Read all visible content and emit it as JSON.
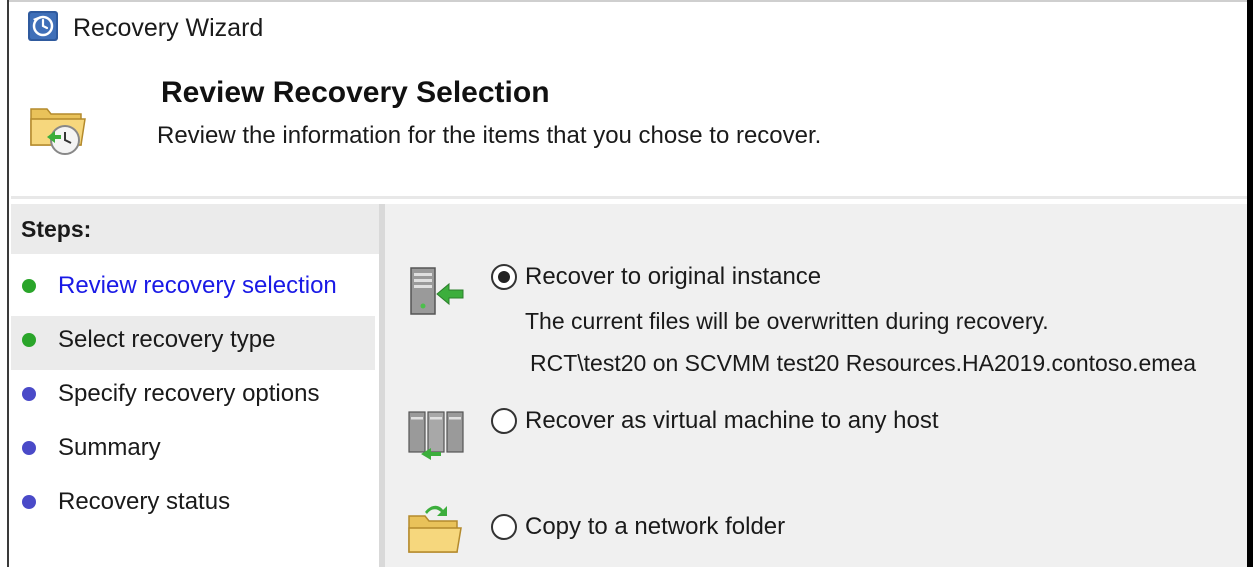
{
  "window": {
    "title": "Recovery Wizard"
  },
  "header": {
    "title": "Review Recovery Selection",
    "subtitle": "Review the information for the items that you chose to recover."
  },
  "steps": {
    "heading": "Steps:",
    "items": [
      {
        "label": "Review recovery selection",
        "state": "current",
        "dot_color": "#2aa52a"
      },
      {
        "label": "Select recovery type",
        "state": "done",
        "dot_color": "#2aa52a"
      },
      {
        "label": "Specify recovery options",
        "state": "pending",
        "dot_color": "#4a4ac8"
      },
      {
        "label": "Summary",
        "state": "pending",
        "dot_color": "#4a4ac8"
      },
      {
        "label": "Recovery status",
        "state": "pending",
        "dot_color": "#4a4ac8"
      }
    ]
  },
  "options": [
    {
      "label": "Recover to original instance",
      "selected": true,
      "icon": "server-restore-icon",
      "details": [
        "The current files will be overwritten during recovery.",
        "RCT\\test20 on SCVMM test20 Resources.HA2019.contoso.emea"
      ]
    },
    {
      "label": "Recover as virtual machine to any host",
      "selected": false,
      "icon": "servers-icon"
    },
    {
      "label": "Copy to a network folder",
      "selected": false,
      "icon": "folder-copy-icon"
    }
  ],
  "colors": {
    "link": "#1a1ae6",
    "accent_green": "#2aa52a",
    "accent_blue": "#4a4ac8"
  }
}
